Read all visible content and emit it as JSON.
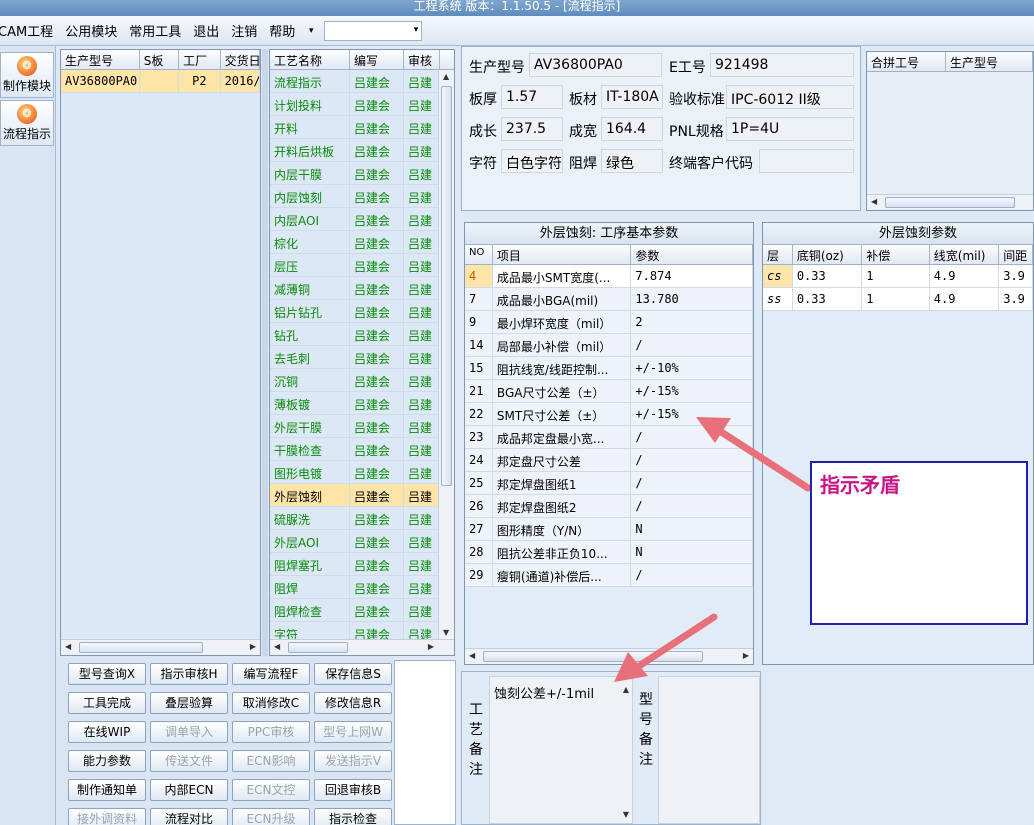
{
  "window": {
    "title": "工程系统  版本：1.1.50.5 - [流程指示]"
  },
  "menu": {
    "items": [
      "CAM工程",
      "公用模块",
      "常用工具",
      "退出",
      "注销",
      "帮助"
    ],
    "dropdown_glyph": "▾"
  },
  "left_nav": {
    "items": [
      {
        "label": "制作模块",
        "icon": "make-module-icon"
      },
      {
        "label": "流程指示",
        "icon": "flow-indicator-icon"
      }
    ]
  },
  "product_list": {
    "columns": [
      "生产型号",
      "S板",
      "工厂",
      "交货日"
    ],
    "rows": [
      [
        "AV36800PA0",
        "",
        "P2",
        "2016/"
      ]
    ]
  },
  "process_list": {
    "columns": [
      "工艺名称",
      "编写",
      "审核"
    ],
    "rows": [
      [
        "流程指示",
        "吕建会",
        "吕建"
      ],
      [
        "计划投料",
        "吕建会",
        "吕建"
      ],
      [
        "开料",
        "吕建会",
        "吕建"
      ],
      [
        "开料后烘板",
        "吕建会",
        "吕建"
      ],
      [
        "内层干膜",
        "吕建会",
        "吕建"
      ],
      [
        "内层蚀刻",
        "吕建会",
        "吕建"
      ],
      [
        "内层AOI",
        "吕建会",
        "吕建"
      ],
      [
        "棕化",
        "吕建会",
        "吕建"
      ],
      [
        "层压",
        "吕建会",
        "吕建"
      ],
      [
        "减薄铜",
        "吕建会",
        "吕建"
      ],
      [
        "铝片钻孔",
        "吕建会",
        "吕建"
      ],
      [
        "钻孔",
        "吕建会",
        "吕建"
      ],
      [
        "去毛刺",
        "吕建会",
        "吕建"
      ],
      [
        "沉铜",
        "吕建会",
        "吕建"
      ],
      [
        "薄板镀",
        "吕建会",
        "吕建"
      ],
      [
        "外层干膜",
        "吕建会",
        "吕建"
      ],
      [
        "干膜检查",
        "吕建会",
        "吕建"
      ],
      [
        "图形电镀",
        "吕建会",
        "吕建"
      ],
      [
        "外层蚀刻",
        "吕建会",
        "吕建"
      ],
      [
        "硫脲洗",
        "吕建会",
        "吕建"
      ],
      [
        "外层AOI",
        "吕建会",
        "吕建"
      ],
      [
        "阻焊塞孔",
        "吕建会",
        "吕建"
      ],
      [
        "阻焊",
        "吕建会",
        "吕建"
      ],
      [
        "阻焊检查",
        "吕建会",
        "吕建"
      ],
      [
        "字符",
        "吕建会",
        "吕建"
      ]
    ],
    "selected_index": 18
  },
  "info": {
    "fields": [
      {
        "label": "生产型号",
        "value": "AV36800PA0"
      },
      {
        "label": "E工号",
        "value": "921498"
      },
      {
        "label": "板厚",
        "value": "1.57"
      },
      {
        "label": "板材",
        "value": "IT-180A"
      },
      {
        "label": "验收标准",
        "value": "IPC-6012 II级"
      },
      {
        "label": "成长",
        "value": "237.5"
      },
      {
        "label": "成宽",
        "value": "164.4"
      },
      {
        "label": "PNL规格",
        "value": "1P=4U"
      },
      {
        "label": "字符",
        "value": "白色字符"
      },
      {
        "label": "阻焊",
        "value": "绿色"
      },
      {
        "label": "终端客户代码",
        "value": ""
      }
    ]
  },
  "combine_list": {
    "columns": [
      "合拼工号",
      "生产型号"
    ]
  },
  "basic_params": {
    "title": "外层蚀刻: 工序基本参数",
    "columns": [
      "NO",
      "项目",
      "参数"
    ],
    "rows": [
      [
        "4",
        "成品最小SMT宽度(...",
        "7.874"
      ],
      [
        "7",
        "成品最小BGA(mil)",
        "13.780"
      ],
      [
        "9",
        "最小焊环宽度（mil）",
        "2"
      ],
      [
        "14",
        "局部最小补偿（mil）",
        "/"
      ],
      [
        "15",
        "阻抗线宽/线距控制...",
        "+/-10%"
      ],
      [
        "21",
        "BGA尺寸公差（±）",
        "+/-15%"
      ],
      [
        "22",
        "SMT尺寸公差（±）",
        "+/-15%"
      ],
      [
        "23",
        "成品邦定盘最小宽...",
        "/"
      ],
      [
        "24",
        "邦定盘尺寸公差",
        "/"
      ],
      [
        "25",
        "邦定焊盘图纸1",
        "/"
      ],
      [
        "26",
        "邦定焊盘图纸2",
        "/"
      ],
      [
        "27",
        "图形精度（Y/N）",
        "N"
      ],
      [
        "28",
        "阻抗公差非正负10...",
        "N"
      ],
      [
        "29",
        "瘦铜(通道)补偿后...",
        "/"
      ]
    ]
  },
  "etch_params": {
    "title": "外层蚀刻参数",
    "columns": [
      "层",
      "底铜(oz)",
      "补偿",
      "线宽(mil)",
      "间距"
    ],
    "rows": [
      [
        "cs",
        "0.33",
        "1",
        "4.9",
        "3.9"
      ],
      [
        "ss",
        "0.33",
        "1",
        "4.9",
        "3.9"
      ]
    ]
  },
  "buttons": [
    {
      "label": "型号查询X",
      "enabled": true
    },
    {
      "label": "指示审核H",
      "enabled": true
    },
    {
      "label": "编写流程F",
      "enabled": true
    },
    {
      "label": "保存信息S",
      "enabled": true
    },
    {
      "label": "工具完成",
      "enabled": true
    },
    {
      "label": "叠层验算",
      "enabled": true
    },
    {
      "label": "取消修改C",
      "enabled": true
    },
    {
      "label": "修改信息R",
      "enabled": true
    },
    {
      "label": "在线WIP",
      "enabled": true
    },
    {
      "label": "调单导入",
      "enabled": false
    },
    {
      "label": "PPC审核",
      "enabled": false
    },
    {
      "label": "型号上网W",
      "enabled": false
    },
    {
      "label": "能力参数",
      "enabled": true
    },
    {
      "label": "传送文件",
      "enabled": false
    },
    {
      "label": "ECN影响",
      "enabled": false
    },
    {
      "label": "发送指示V",
      "enabled": false
    },
    {
      "label": "制作通知单",
      "enabled": true
    },
    {
      "label": "内部ECN",
      "enabled": true
    },
    {
      "label": "ECN文控",
      "enabled": false
    },
    {
      "label": "回退审核B",
      "enabled": true
    },
    {
      "label": "接外调资料",
      "enabled": false
    },
    {
      "label": "流程对比",
      "enabled": true
    },
    {
      "label": "ECN升级",
      "enabled": false
    },
    {
      "label": "指示检查",
      "enabled": true
    }
  ],
  "remarks": {
    "process_label": "工艺备注",
    "process_text": "蚀刻公差+/-1mil",
    "model_label": "型号备注"
  },
  "annotation": {
    "text": "指示矛盾",
    "arrow_color": "#e8707a"
  },
  "colors": {
    "process_name": "#0a8a0a",
    "selected_row": "#ffe6a8",
    "annotation_text": "#c71585",
    "annotation_border": "#1f1fb0"
  }
}
